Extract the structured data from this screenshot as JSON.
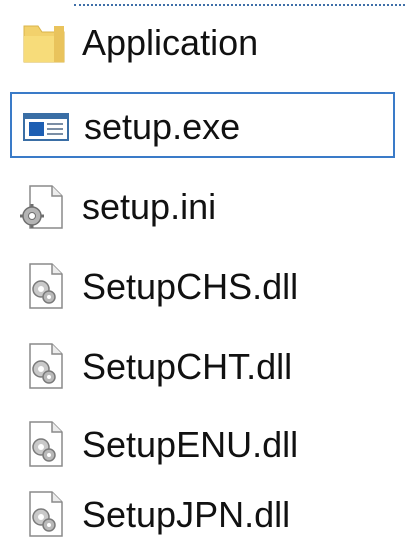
{
  "file_list": {
    "items": [
      {
        "name": "Application",
        "icon": "folder-icon",
        "selected": false
      },
      {
        "name": "setup.exe",
        "icon": "exe-app-icon",
        "selected": true
      },
      {
        "name": "setup.ini",
        "icon": "settings-file-icon",
        "selected": false
      },
      {
        "name": "SetupCHS.dll",
        "icon": "dll-file-icon",
        "selected": false
      },
      {
        "name": "SetupCHT.dll",
        "icon": "dll-file-icon",
        "selected": false
      },
      {
        "name": "SetupENU.dll",
        "icon": "dll-file-icon",
        "selected": false
      },
      {
        "name": "SetupJPN.dll",
        "icon": "dll-file-icon",
        "selected": false
      }
    ]
  },
  "colors": {
    "selection_border": "#3a7bc8",
    "folder_fill": "#f2d16c",
    "text": "#111111"
  }
}
